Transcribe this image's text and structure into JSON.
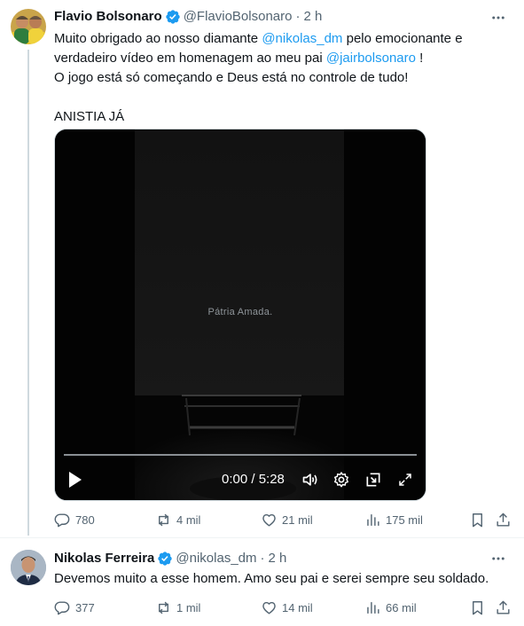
{
  "tweet1": {
    "author_name": "Flavio Bolsonaro",
    "handle": "@FlavioBolsonaro",
    "separator": "·",
    "time": "2 h",
    "text": {
      "l1_a": "Muito obrigado ao nosso diamante ",
      "l1_mention": "@nikolas_dm",
      "l1_b": " pelo emocionante e",
      "l2_a": "verdadeiro vídeo em homenagem ao meu pai ",
      "l2_mention": "@jairbolsonaro",
      "l2_b": " !",
      "l3": "O jogo está só começando e Deus está no controle de tudo!",
      "l4": "ANISTIA JÁ"
    },
    "video": {
      "caption": "Pátria Amada.",
      "timecode": "0:00 / 5:28",
      "progress": 0
    },
    "stats": {
      "replies": "780",
      "reposts": "4 mil",
      "likes": "21 mil",
      "views": "175 mil"
    }
  },
  "tweet2": {
    "author_name": "Nikolas Ferreira",
    "handle": "@nikolas_dm",
    "separator": "·",
    "time": "2 h",
    "text": "Devemos muito a esse homem. Amo seu pai e serei sempre seu soldado.",
    "stats": {
      "replies": "377",
      "reposts": "1 mil",
      "likes": "14 mil",
      "views": "66 mil"
    }
  },
  "icons": {
    "verified": "verified-badge-icon",
    "more": "more-dots-icon",
    "reply": "reply-icon",
    "repost": "repost-icon",
    "like": "heart-icon",
    "views": "views-icon",
    "bookmark": "bookmark-icon",
    "share": "share-icon"
  },
  "colors": {
    "accent": "#1d9bf0",
    "text": "#0f1419",
    "muted": "#536471",
    "border": "#eff3f4"
  }
}
